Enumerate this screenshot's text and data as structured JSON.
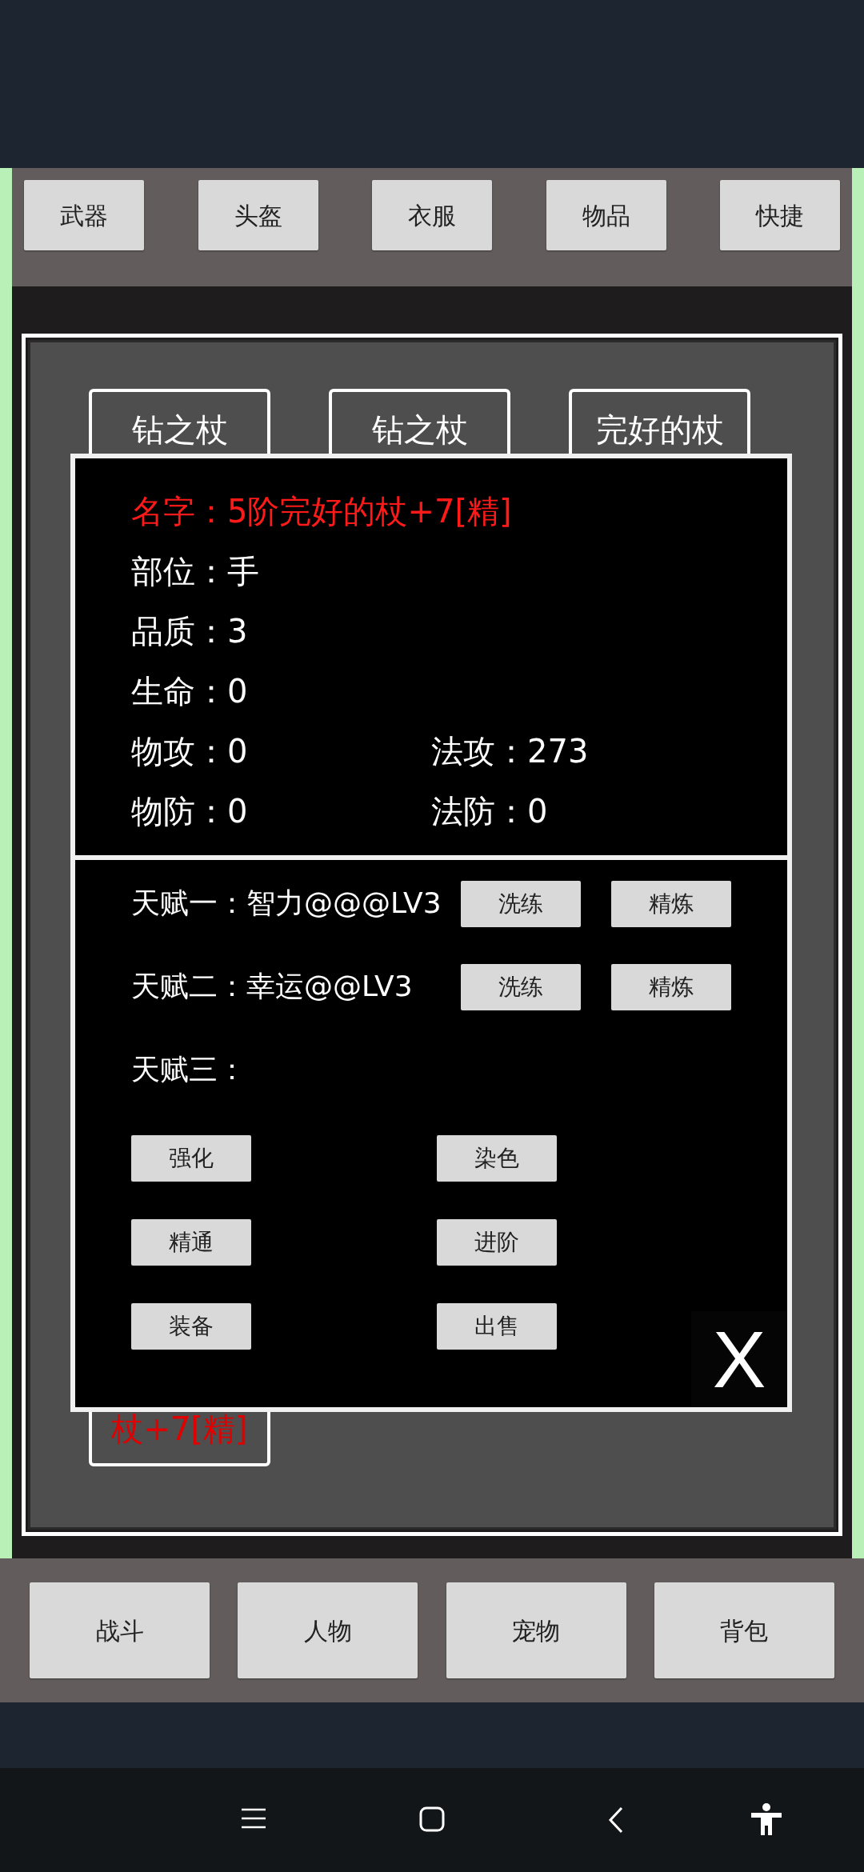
{
  "top_tabs": [
    {
      "label": "武器"
    },
    {
      "label": "头盔"
    },
    {
      "label": "衣服"
    },
    {
      "label": "物品"
    },
    {
      "label": "快捷"
    }
  ],
  "item_cards": [
    {
      "label": "钻之杖"
    },
    {
      "label": "钻之杖"
    },
    {
      "label": "完好的杖"
    }
  ],
  "bottom_card": {
    "label": "杖+7[精]"
  },
  "detail": {
    "name": "名字：5阶完好的杖+7[精]",
    "stats": [
      {
        "label": "部位：手"
      },
      {
        "label": "品质：3"
      },
      {
        "label": "生命：0"
      },
      {
        "label": "物攻：0",
        "right": "法攻：273"
      },
      {
        "label": "物防：0",
        "right": "法防：0"
      }
    ],
    "talents": [
      {
        "label": "天赋一：智力@@@LV3",
        "buttons": [
          "洗练",
          "精炼"
        ]
      },
      {
        "label": "天赋二：幸运@@LV3",
        "buttons": [
          "洗练",
          "精炼"
        ]
      },
      {
        "label": "天赋三："
      }
    ],
    "actions": [
      "强化",
      "染色",
      "精通",
      "进阶",
      "装备",
      "出售"
    ],
    "close": "X"
  },
  "bottom_nav": [
    {
      "label": "战斗"
    },
    {
      "label": "人物"
    },
    {
      "label": "宠物"
    },
    {
      "label": "背包"
    }
  ]
}
